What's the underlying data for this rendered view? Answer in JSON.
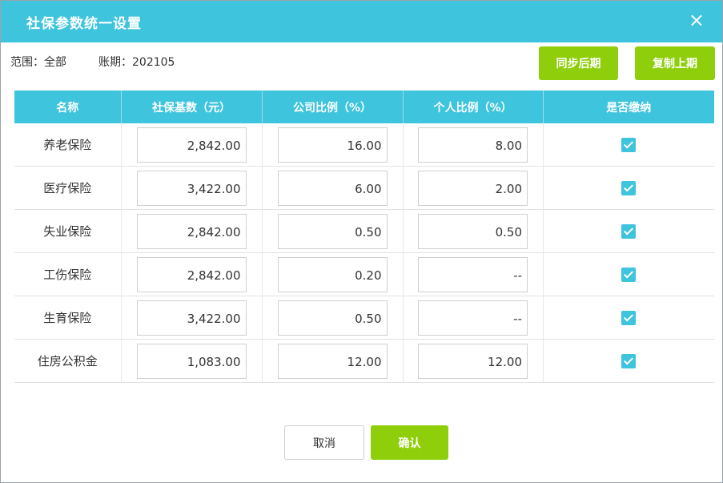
{
  "dialog": {
    "title": "社保参数统一设置",
    "close_icon": "×"
  },
  "meta": {
    "scope": "范围：全部",
    "period": "账期：202105"
  },
  "toolbar": {
    "sync_label": "同步后期",
    "copy_label": "复制上期"
  },
  "table": {
    "headers": [
      "名称",
      "社保基数（元）",
      "公司比例（%）",
      "个人比例（%）",
      "是否缴纳"
    ],
    "rows": [
      {
        "name": "养老保险",
        "base": "2,842.00",
        "company": "16.00",
        "personal": "8.00",
        "paid": true
      },
      {
        "name": "医疗保险",
        "base": "3,422.00",
        "company": "6.00",
        "personal": "2.00",
        "paid": true
      },
      {
        "name": "失业保险",
        "base": "2,842.00",
        "company": "0.50",
        "personal": "0.50",
        "paid": true
      },
      {
        "name": "工伤保险",
        "base": "2,842.00",
        "company": "0.20",
        "personal": "--",
        "paid": true
      },
      {
        "name": "生育保险",
        "base": "3,422.00",
        "company": "0.50",
        "personal": "--",
        "paid": true
      },
      {
        "name": "住房公积金",
        "base": "1,083.00",
        "company": "12.00",
        "personal": "12.00",
        "paid": true
      }
    ]
  },
  "footer": {
    "cancel_label": "取消",
    "ok_label": "确认"
  },
  "colors": {
    "accent": "#3ec4dd",
    "button_green": "#8fce0b"
  }
}
